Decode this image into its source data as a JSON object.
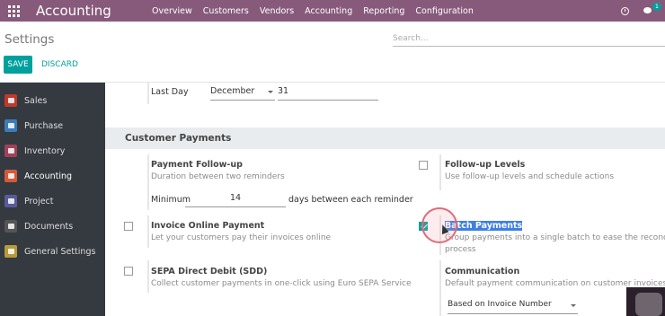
{
  "navbar": {
    "brand": "Accounting",
    "menu": [
      "Overview",
      "Customers",
      "Vendors",
      "Accounting",
      "Reporting",
      "Configuration"
    ],
    "chat_badge": "1",
    "bg_color": "#875a7b"
  },
  "control": {
    "title": "Settings",
    "search_placeholder": "Search...",
    "save_label": "SAVE",
    "discard_label": "DISCARD"
  },
  "sidebar": {
    "items": [
      {
        "label": "Sales",
        "icon": "sales-icon",
        "color": "#c0392b"
      },
      {
        "label": "Purchase",
        "icon": "purchase-icon",
        "color": "#3b7cb8"
      },
      {
        "label": "Inventory",
        "icon": "inventory-icon",
        "color": "#a0415a"
      },
      {
        "label": "Accounting",
        "icon": "accounting-icon",
        "color": "#d35a3b"
      },
      {
        "label": "Project",
        "icon": "project-icon",
        "color": "#5a5a9a"
      },
      {
        "label": "Documents",
        "icon": "documents-icon",
        "color": "#555"
      },
      {
        "label": "General Settings",
        "icon": "settings-icon",
        "color": "#b79a3a"
      }
    ]
  },
  "fiscal": {
    "last_day_label": "Last Day",
    "month": "December",
    "day": "31"
  },
  "customer_payments": {
    "section_title": "Customer Payments",
    "followup": {
      "title": "Payment Follow-up",
      "desc": "Duration between two reminders",
      "minimum_label": "Minimum",
      "minimum_value": "14",
      "days_label": "days between each reminder"
    },
    "followup_levels": {
      "title": "Follow-up Levels",
      "desc": "Use follow-up levels and schedule actions",
      "checked": false
    },
    "invoice_online": {
      "title": "Invoice Online Payment",
      "desc": "Let your customers pay their invoices online",
      "checked": false
    },
    "batch_payments": {
      "title": "Batch Payments",
      "desc_line1": "Group payments into a single batch to ease the reconciliation",
      "desc_line2": "process",
      "checked": true
    },
    "sepa": {
      "title": "SEPA Direct Debit (SDD)",
      "desc": "Collect customer payments in one-click using Euro SEPA Service",
      "checked": false
    },
    "communication": {
      "title": "Communication",
      "desc": "Default payment communication on customer invoices",
      "value": "Based on Invoice Number"
    }
  },
  "accent_color": "#00a09d"
}
